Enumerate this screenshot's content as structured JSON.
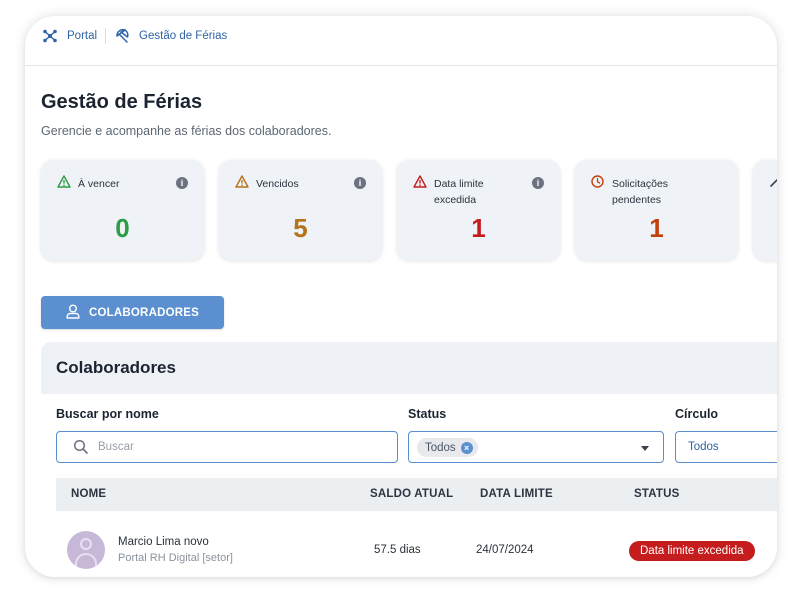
{
  "breadcrumb": {
    "items": [
      {
        "label": "Portal",
        "icon": "portal-icon"
      },
      {
        "label": "Gestão de Férias",
        "icon": "beach-umbrella-icon"
      }
    ]
  },
  "page": {
    "title": "Gestão de Férias",
    "subtitle": "Gerencie e acompanhe as férias dos colaboradores."
  },
  "cards": [
    {
      "label": "À vencer",
      "value": "0",
      "icon": "warning-triangle-icon",
      "color": "#2e9b45"
    },
    {
      "label": "Vencidos",
      "value": "5",
      "icon": "warning-triangle-icon",
      "color": "#b5731a"
    },
    {
      "label": "Data limite excedida",
      "value": "1",
      "icon": "warning-triangle-icon",
      "color": "#c51d1d"
    },
    {
      "label": "Solicitações pendentes",
      "value": "1",
      "icon": "clock-icon",
      "color": "#c2410c"
    }
  ],
  "tabs": {
    "colaboradores": {
      "label": "COLABORADORES",
      "icon": "user-icon"
    }
  },
  "panel": {
    "title": "Colaboradores"
  },
  "filters": {
    "search": {
      "label": "Buscar por nome",
      "placeholder": "Buscar",
      "value": ""
    },
    "status": {
      "label": "Status",
      "selected_chip": "Todos"
    },
    "circle": {
      "label": "Círculo",
      "value": "Todos"
    }
  },
  "table": {
    "headers": [
      "NOME",
      "SALDO ATUAL",
      "DATA LIMITE",
      "STATUS"
    ],
    "rows": [
      {
        "name": "Marcio Lima novo",
        "sector": "Portal RH Digital [setor]",
        "balance": "57.5 dias",
        "deadline": "24/07/2024",
        "status": "Data limite excedida",
        "status_color": "#c51d1d"
      }
    ]
  },
  "colors": {
    "accent": "#5b8fd0",
    "link": "#2f64a6",
    "card_bg": "#eff2f6"
  }
}
